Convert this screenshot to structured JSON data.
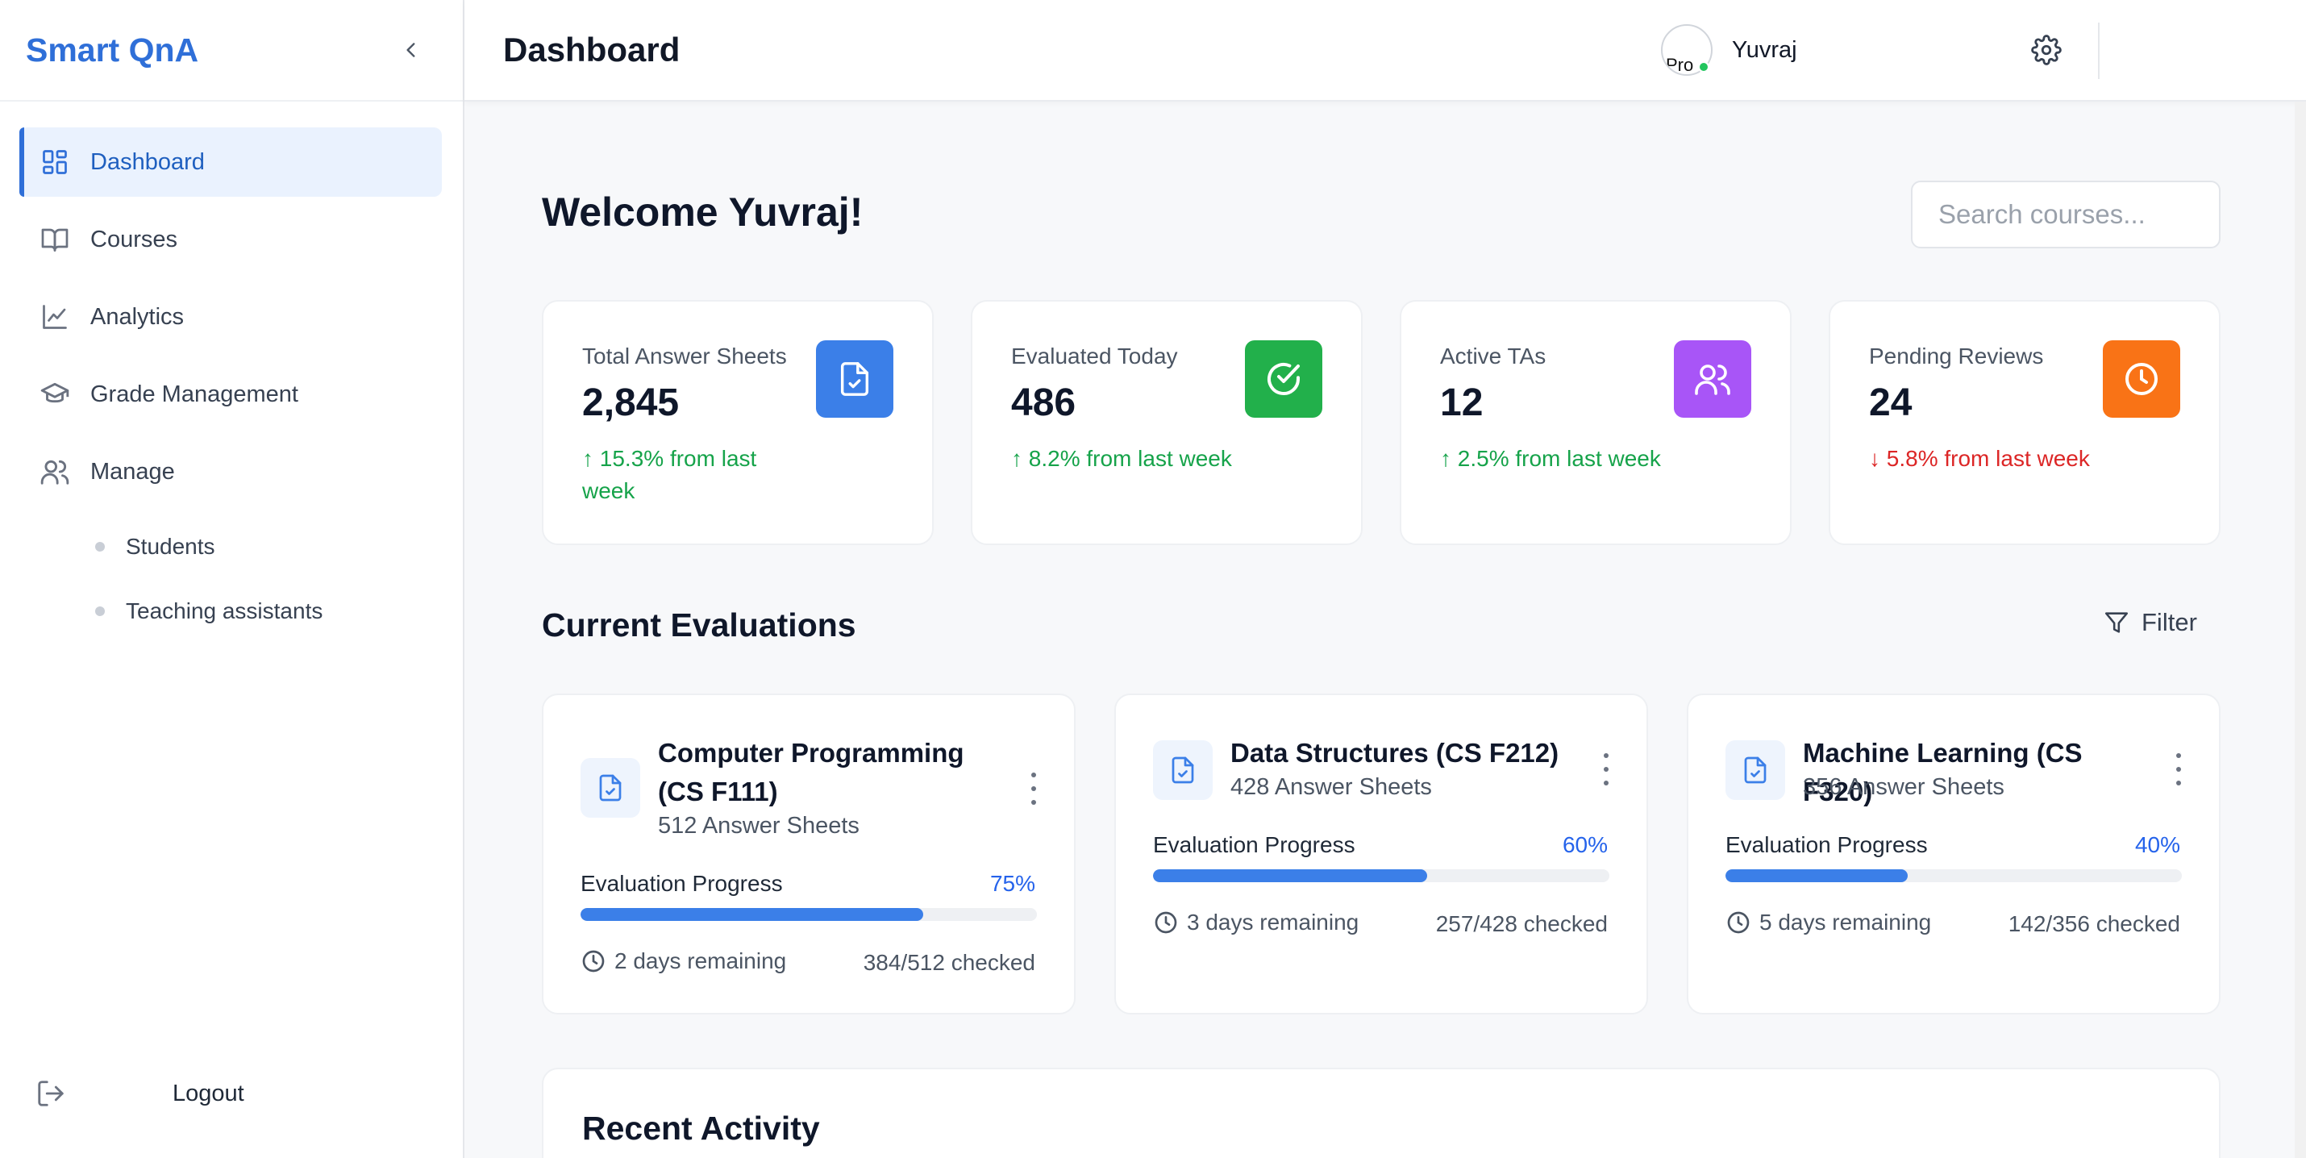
{
  "sidebar": {
    "brand": "Smart QnA",
    "nav": [
      {
        "label": "Dashboard",
        "icon": "dashboard-grid-icon",
        "active": true
      },
      {
        "label": "Courses",
        "icon": "book-open-icon"
      },
      {
        "label": "Analytics",
        "icon": "line-chart-icon"
      },
      {
        "label": "Grade Management",
        "icon": "graduation-cap-icon"
      },
      {
        "label": "Manage",
        "icon": "users-icon"
      }
    ],
    "sub_items": [
      {
        "label": "Students"
      },
      {
        "label": "Teaching assistants"
      }
    ],
    "logout": "Logout"
  },
  "topbar": {
    "title": "Dashboard",
    "user_name": "Yuvraj",
    "avatar_alt": "Pro"
  },
  "main": {
    "welcome": "Welcome Yuvraj!",
    "search_placeholder": "Search courses...",
    "stats": [
      {
        "label": "Total Answer Sheets",
        "value": "2,845",
        "change": "↑ 15.3% from last week",
        "trend": "up",
        "icon": "document-check-icon",
        "color": "#3b7fe8"
      },
      {
        "label": "Evaluated Today",
        "value": "486",
        "change": "↑ 8.2% from last week",
        "trend": "up",
        "icon": "check-circle-icon",
        "color": "#22b04b"
      },
      {
        "label": "Active TAs",
        "value": "12",
        "change": "↑ 2.5% from last week",
        "trend": "up",
        "icon": "users-icon",
        "color": "#a855f7"
      },
      {
        "label": "Pending Reviews",
        "value": "24",
        "change": "↓ 5.8% from last week",
        "trend": "down",
        "icon": "clock-icon",
        "color": "#f97316"
      }
    ],
    "evaluations_title": "Current Evaluations",
    "filter_label": "Filter",
    "progress_label": "Evaluation Progress",
    "evaluations": [
      {
        "title": "Computer Programming (CS F111)",
        "sheets": "512 Answer Sheets",
        "progress": 75,
        "progress_text": "75%",
        "remaining": "2 days remaining",
        "checked": "384/512 checked"
      },
      {
        "title": "Data Structures (CS F212)",
        "sheets": "428 Answer Sheets",
        "progress": 60,
        "progress_text": "60%",
        "remaining": "3 days remaining",
        "checked": "257/428 checked"
      },
      {
        "title": "Machine Learning (CS F320)",
        "sheets": "356 Answer Sheets",
        "progress": 40,
        "progress_text": "40%",
        "remaining": "5 days remaining",
        "checked": "142/356 checked"
      }
    ],
    "recent_activity_title": "Recent Activity"
  }
}
